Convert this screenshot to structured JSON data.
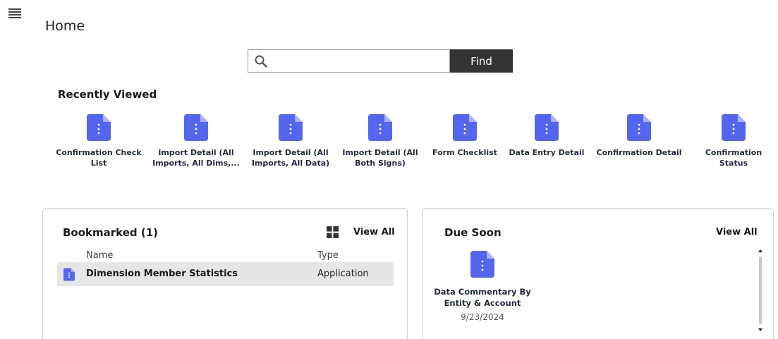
{
  "header": {
    "title": "Home"
  },
  "search": {
    "placeholder": "",
    "value": "",
    "find_label": "Find"
  },
  "recently_viewed": {
    "title": "Recently Viewed",
    "items": [
      {
        "label": "Confirmation Check List"
      },
      {
        "label": "Import Detail (All Imports, All Dims,..."
      },
      {
        "label": "Import Detail (All Imports, All Data)"
      },
      {
        "label": "Import Detail (All Both Signs)"
      },
      {
        "label": "Form Checklist"
      },
      {
        "label": "Data Entry Detail"
      },
      {
        "label": "Confirmation Detail"
      },
      {
        "label": "Confirmation Status"
      }
    ]
  },
  "bookmarked": {
    "title": "Bookmarked (1)",
    "view_all_label": "View All",
    "columns": {
      "name": "Name",
      "type": "Type"
    },
    "rows": [
      {
        "name": "Dimension Member Statistics",
        "type": "Application"
      }
    ]
  },
  "due_soon": {
    "title": "Due Soon",
    "view_all_label": "View All",
    "items": [
      {
        "name": "Data Commentary By Entity & Account",
        "date": "9/23/2024"
      }
    ]
  },
  "icons": {
    "menu": "hamburger-menu-icon",
    "search": "search-icon",
    "document": "document-icon",
    "grid": "grid-view-icon"
  },
  "colors": {
    "document_icon": "#5566ee",
    "find_button": "#333333",
    "selected_row": "#e6e6e6"
  }
}
